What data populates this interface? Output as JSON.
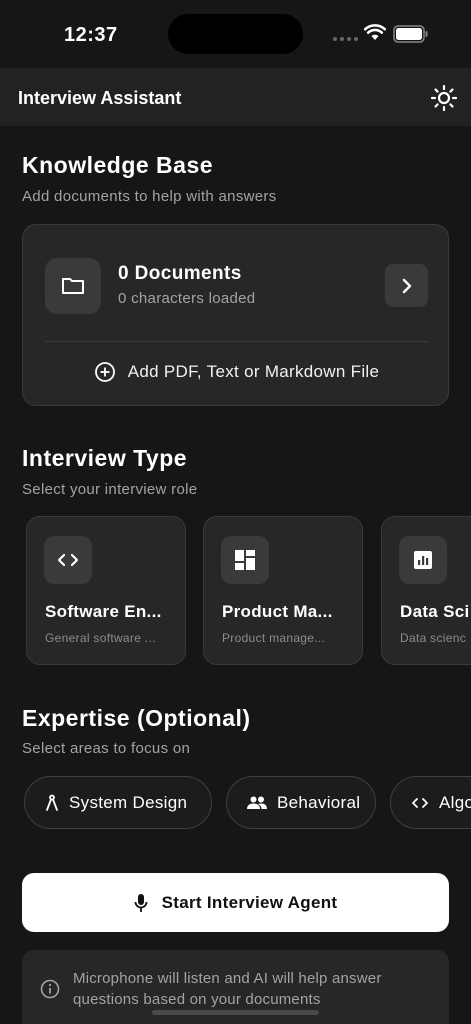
{
  "status_bar": {
    "time": "12:37"
  },
  "header": {
    "title": "Interview Assistant",
    "theme_icon": "sun-icon"
  },
  "knowledge_base": {
    "title": "Knowledge Base",
    "subtitle": "Add documents to help with answers",
    "documents_label": "0 Documents",
    "characters_label": "0 characters loaded",
    "add_label": "Add PDF, Text or Markdown File"
  },
  "interview_type": {
    "title": "Interview Type",
    "subtitle": "Select your interview role",
    "cards": [
      {
        "title": "Software En...",
        "desc": "General software ...",
        "icon": "code-icon"
      },
      {
        "title": "Product Ma...",
        "desc": "Product manage...",
        "icon": "dashboard-icon"
      },
      {
        "title": "Data Sci",
        "desc": "Data scienc",
        "icon": "chart-icon"
      }
    ]
  },
  "expertise": {
    "title": "Expertise (Optional)",
    "subtitle": "Select areas to focus on",
    "chips": [
      {
        "label": "System Design",
        "icon": "compass-icon"
      },
      {
        "label": "Behavioral",
        "icon": "people-icon"
      },
      {
        "label": "Algo",
        "icon": "code-icon"
      }
    ]
  },
  "start_button": {
    "label": "Start Interview Agent",
    "icon": "mic-icon"
  },
  "info": {
    "text": "Microphone will listen and AI will help answer questions based on your documents",
    "icon": "info-icon"
  },
  "colors": {
    "background": "#161616",
    "card": "#272727",
    "header": "#222222",
    "accent": "#ffffff"
  }
}
